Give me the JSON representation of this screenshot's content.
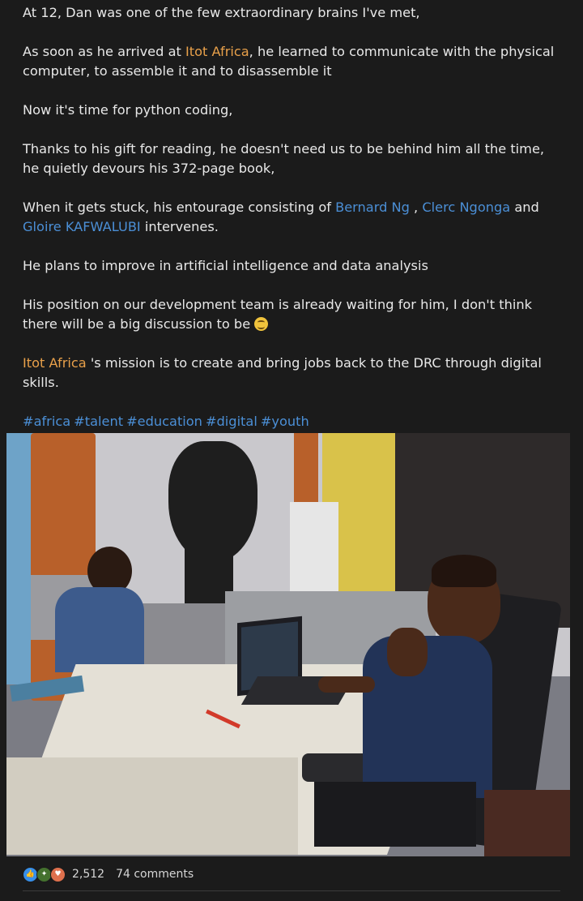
{
  "post": {
    "line1": "At 12, Dan was one of the few extraordinary brains I've met,",
    "line2_pre": "As soon as he arrived at ",
    "org_link": "Itot Africa",
    "line2_post": ", he learned to communicate with the physical computer, to assemble it and to disassemble it",
    "line3": "Now it's time for python coding,",
    "line4": "Thanks to his gift for reading, he doesn't need us to be behind him all the time, he quietly devours his 372-page book,",
    "line5_pre": "When it gets stuck, his entourage consisting of ",
    "person1": "Bernard Ng",
    "sep1": " , ",
    "person2": "Clerc Ngonga",
    "sep2": " and ",
    "person3": "Gloire KAFWALUBI",
    "line5_post": " intervenes.",
    "line6": "He plans to improve in artificial intelligence and data analysis",
    "line7": "His position on our development team is already waiting for him, I don't think there will be a big discussion to be ",
    "emoji": "smiling-face-with-halo",
    "line8_post": " 's mission is to create and bring jobs back to the DRC through digital skills.",
    "hashtags": [
      "#africa",
      "#talent",
      "#education",
      "#digital",
      "#youth"
    ]
  },
  "image": {
    "description_icon": "photo-boy-at-desk-with-laptop"
  },
  "social": {
    "reactions": [
      "like-icon",
      "celebrate-icon",
      "love-icon"
    ],
    "reaction_count": "2,512",
    "comments": "74 comments"
  },
  "colors": {
    "background": "#1b1b1b",
    "org_link": "#e8a04a",
    "person_link": "#4b8fd6",
    "hashtag": "#4b8fd6"
  }
}
